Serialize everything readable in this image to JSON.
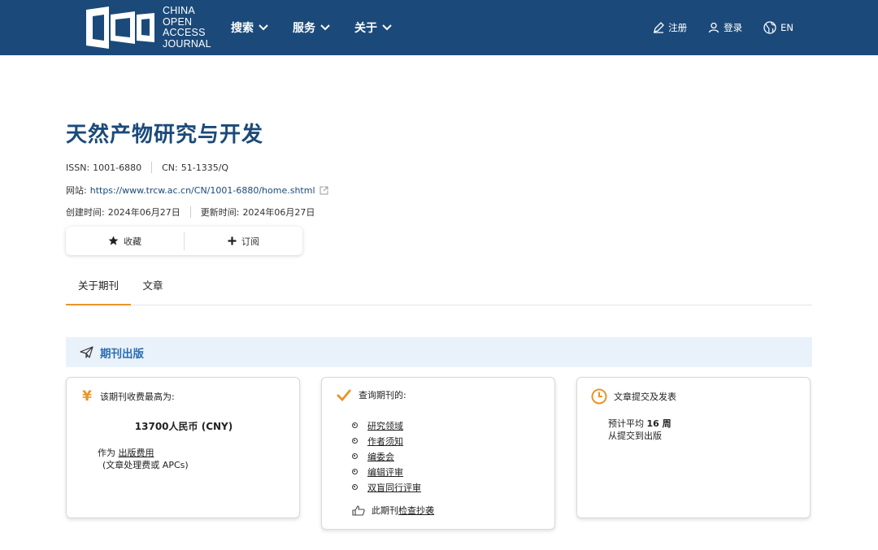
{
  "header": {
    "logo_lines": [
      "CHINA",
      "OPEN",
      "ACCESS",
      "JOURNAL"
    ],
    "nav": [
      {
        "label": "搜索"
      },
      {
        "label": "服务"
      },
      {
        "label": "关于"
      }
    ],
    "register_label": "注册",
    "login_label": "登录",
    "language_label": "EN"
  },
  "journal": {
    "title": "天然产物研究与开发",
    "issn_label": "ISSN:",
    "issn": "1001-6880",
    "cn_label": "CN:",
    "cn": "51-1335/Q",
    "website_label": "网站:",
    "website": "https://www.trcw.ac.cn/CN/1001-6880/home.shtml",
    "created_label": "创建时间:",
    "created": "2024年06月27日",
    "updated_label": "更新时间:",
    "updated": "2024年06月27日"
  },
  "actions": {
    "favorite_label": "收藏",
    "subscribe_label": "订阅"
  },
  "tabs": [
    {
      "label": "关于期刊",
      "active": true
    },
    {
      "label": "文章",
      "active": false
    }
  ],
  "section": {
    "title": "期刊出版"
  },
  "fee_card": {
    "heading": "该期刊收费最高为:",
    "amount": "13700人民币 (CNY)",
    "note_prefix": "作为",
    "note_link": "出版费用",
    "note_sub": "(文章处理费或 APCs)"
  },
  "check_card": {
    "heading": "查询期刊的:",
    "items": [
      "研究领域",
      "作者须知",
      "编委会",
      "编辑评审",
      "双盲同行评审"
    ],
    "plagiarism_prefix": "此期刊",
    "plagiarism_link": "检查抄袭"
  },
  "time_card": {
    "heading": "文章提交及发表",
    "prefix": "预计平均",
    "weeks": "16 周",
    "suffix": "从提交到出版"
  },
  "colors": {
    "header_bg": "#1b4a7a",
    "accent_orange": "#e8942a",
    "band_bg": "#e9f2fb",
    "band_title": "#2a6db5"
  }
}
